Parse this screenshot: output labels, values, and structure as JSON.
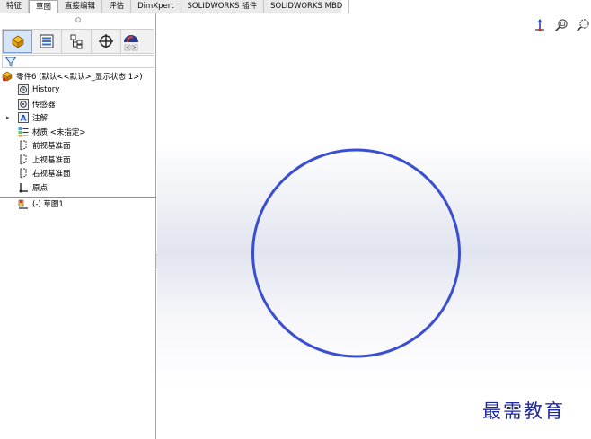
{
  "tabs": [
    {
      "label": "特征"
    },
    {
      "label": "草图"
    },
    {
      "label": "直接编辑"
    },
    {
      "label": "评估"
    },
    {
      "label": "DimXpert"
    },
    {
      "label": "SOLIDWORKS 插件"
    },
    {
      "label": "SOLIDWORKS MBD"
    }
  ],
  "active_tab": "草图",
  "tree": {
    "root": "零件6 (默认<<默认>_显示状态 1>)",
    "items": [
      {
        "label": "History",
        "icon": "history-icon"
      },
      {
        "label": "传感器",
        "icon": "sensor-icon"
      },
      {
        "label": "注解",
        "icon": "annotation-icon"
      },
      {
        "label": "材质 <未指定>",
        "icon": "material-icon"
      },
      {
        "label": "前视基准面",
        "icon": "plane-icon"
      },
      {
        "label": "上视基准面",
        "icon": "plane-icon"
      },
      {
        "label": "右视基准面",
        "icon": "plane-icon"
      },
      {
        "label": "原点",
        "icon": "origin-icon"
      }
    ],
    "sketch": "(-) 草图1"
  },
  "colors": {
    "sketch_entity": "#3a4fd0",
    "watermark": "#1f2a9a",
    "active_tab_bg": "#d5e4f7"
  },
  "watermark": "最需教育"
}
